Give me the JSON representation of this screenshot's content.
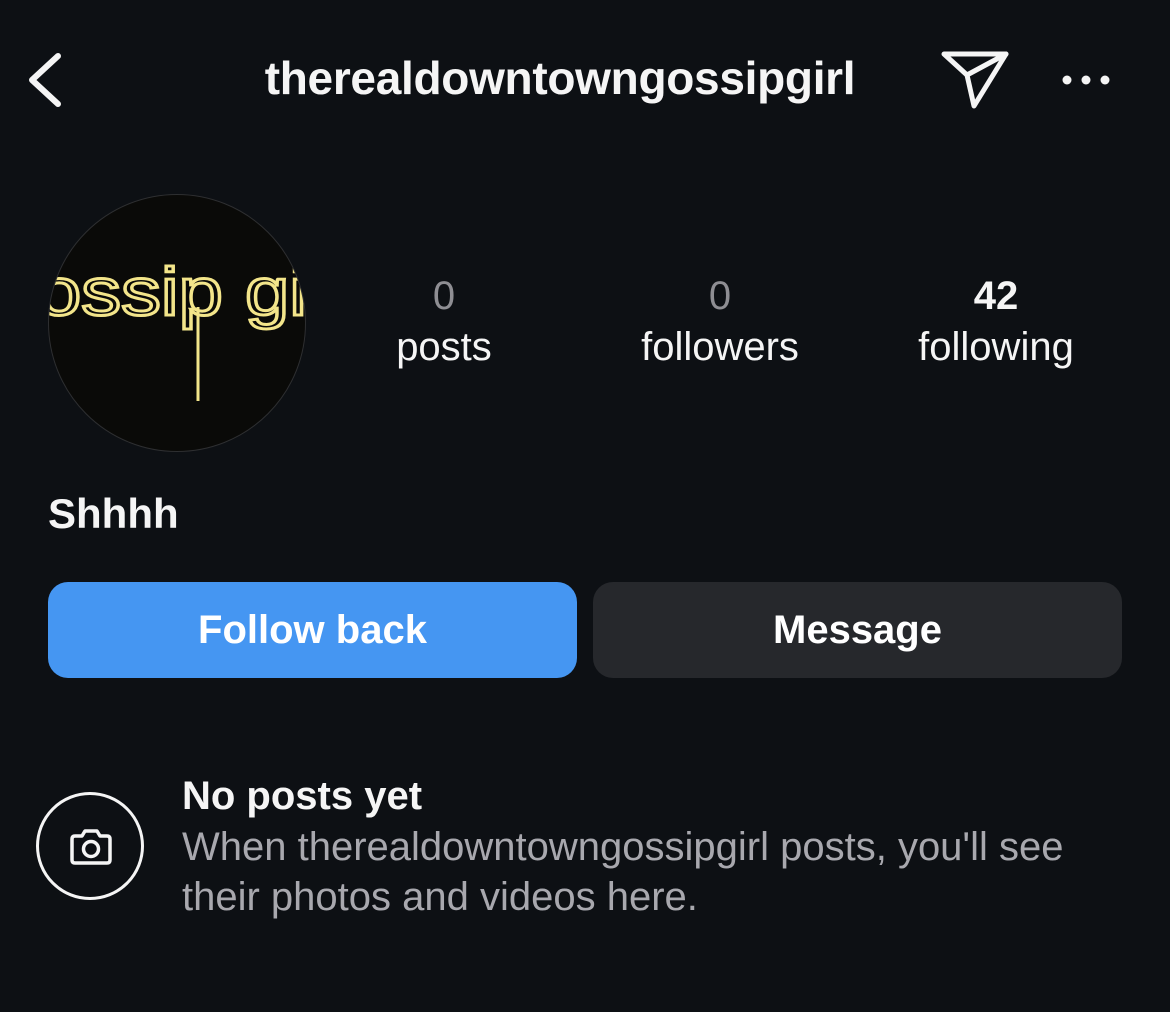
{
  "header": {
    "back_icon": "chevron-left-icon",
    "username": "therealdowntowngossipgirl",
    "send_icon": "paper-plane-icon",
    "more_icon": "more-horizontal-icon"
  },
  "profile": {
    "avatar_text": "gossip girl",
    "stats": {
      "posts": {
        "value": "0",
        "label": "posts"
      },
      "followers": {
        "value": "0",
        "label": "followers"
      },
      "following": {
        "value": "42",
        "label": "following"
      }
    },
    "bio": "Shhhh"
  },
  "actions": {
    "follow_back_label": "Follow back",
    "message_label": "Message"
  },
  "empty_state": {
    "icon": "camera-icon",
    "title": "No posts yet",
    "text": "When therealdowntowngossipgirl posts, you'll see their photos and videos here."
  },
  "colors": {
    "background": "#0d1014",
    "follow_button": "#4596f2",
    "message_button": "#26282c",
    "secondary_text": "#a8a8ae",
    "avatar_glow": "#f3e58a"
  }
}
